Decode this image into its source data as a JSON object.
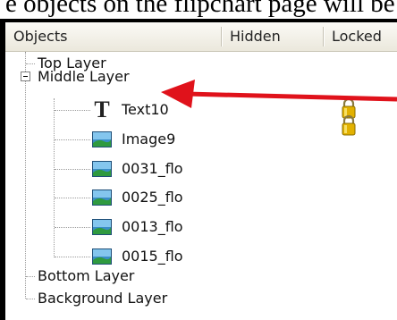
{
  "caption": "e objects on the flipchart page will be",
  "header": {
    "objects": "Objects",
    "hidden": "Hidden",
    "locked": "Locked"
  },
  "layers": {
    "top": "Top Layer",
    "middle": "Middle Layer",
    "bottom": "Bottom Layer",
    "background": "Background Layer"
  },
  "items": [
    {
      "label": "Text10",
      "icon": "text-tool-icon",
      "locked": true
    },
    {
      "label": "Image9",
      "icon": "image-icon",
      "locked": true
    },
    {
      "label": "0031_flo",
      "icon": "image-icon",
      "locked": false
    },
    {
      "label": "0025_flo",
      "icon": "image-icon",
      "locked": false
    },
    {
      "label": "0013_flo",
      "icon": "image-icon",
      "locked": false
    },
    {
      "label": "0015_flo",
      "icon": "image-icon",
      "locked": false
    }
  ],
  "colors": {
    "arrow": "#e0121b",
    "lock": "#d9a800"
  }
}
